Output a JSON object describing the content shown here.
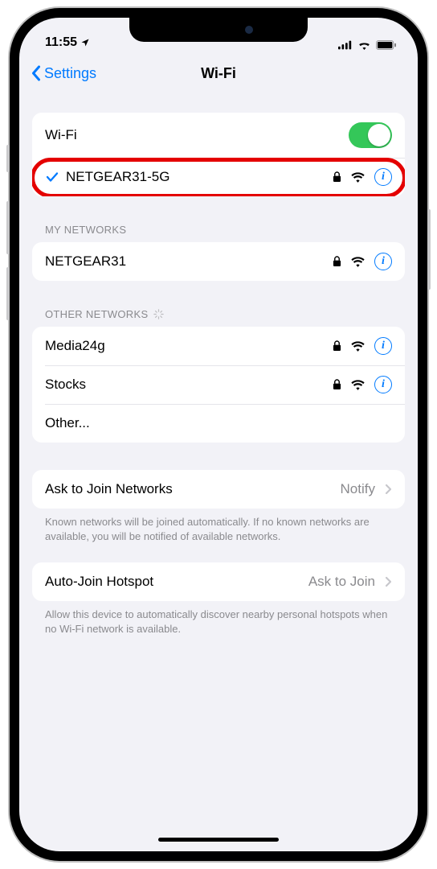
{
  "status": {
    "time": "11:55",
    "location_active": true
  },
  "nav": {
    "back_label": "Settings",
    "title": "Wi-Fi"
  },
  "wifi": {
    "label": "Wi-Fi",
    "enabled": true
  },
  "connected_network": {
    "name": "NETGEAR31-5G",
    "secured": true,
    "highlighted": true
  },
  "sections": {
    "my_networks": {
      "header": "MY NETWORKS",
      "items": [
        {
          "name": "NETGEAR31",
          "secured": true
        }
      ]
    },
    "other_networks": {
      "header": "OTHER NETWORKS",
      "loading": true,
      "items": [
        {
          "name": "Media24g",
          "secured": true
        },
        {
          "name": "Stocks",
          "secured": true
        }
      ],
      "other_label": "Other..."
    }
  },
  "ask_to_join": {
    "label": "Ask to Join Networks",
    "value": "Notify",
    "footer": "Known networks will be joined automatically. If no known networks are available, you will be notified of available networks."
  },
  "auto_hotspot": {
    "label": "Auto-Join Hotspot",
    "value": "Ask to Join",
    "footer": "Allow this device to automatically discover nearby personal hotspots when no Wi-Fi network is available."
  }
}
